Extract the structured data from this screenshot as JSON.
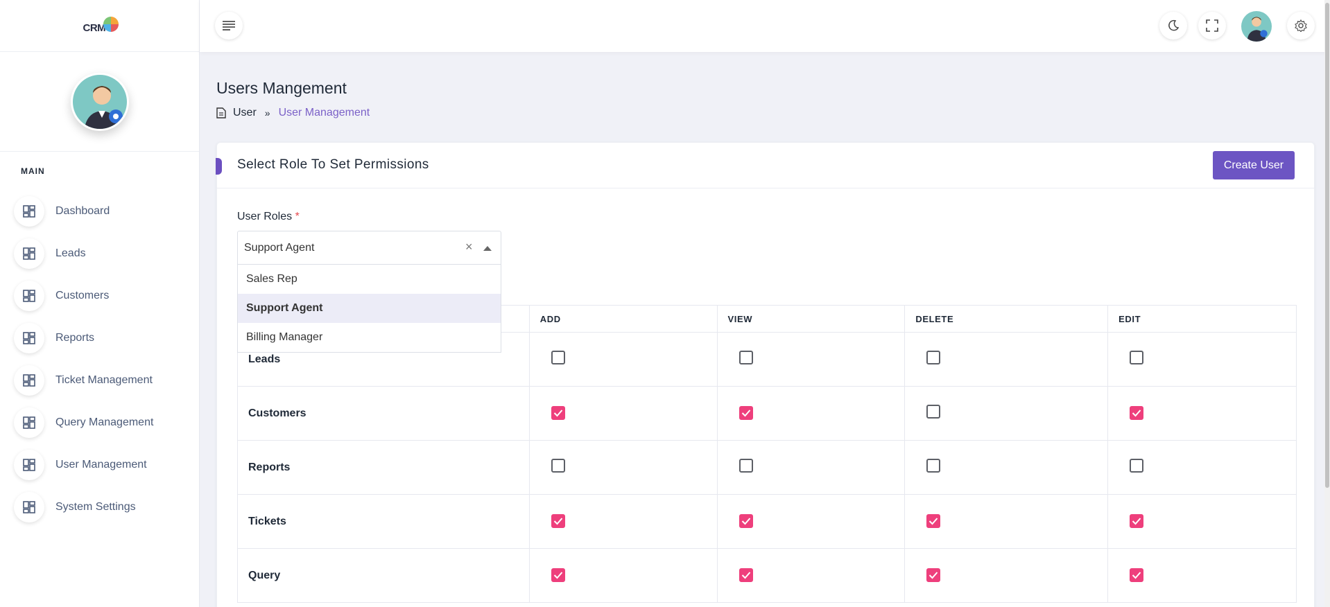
{
  "app": {
    "logo_text": "CRM"
  },
  "sidebar": {
    "section_label": "MAIN",
    "items": [
      {
        "label": "Dashboard"
      },
      {
        "label": "Leads"
      },
      {
        "label": "Customers"
      },
      {
        "label": "Reports"
      },
      {
        "label": "Ticket Management"
      },
      {
        "label": "Query Management"
      },
      {
        "label": "User Management"
      },
      {
        "label": "System Settings"
      }
    ]
  },
  "header": {
    "menu_icon": "menu-icon",
    "dark_mode_icon": "moon-icon",
    "fullscreen_icon": "fullscreen-icon",
    "settings_icon": "gear-icon"
  },
  "page": {
    "title": "Users Mangement",
    "breadcrumb": {
      "root": "User",
      "current": "User Management"
    }
  },
  "card": {
    "title": "Select Role To Set Permissions",
    "create_button": "Create User",
    "field_label": "User Roles",
    "required_mark": "*",
    "select": {
      "value": "Support Agent",
      "clear": "×",
      "options": [
        {
          "label": "Sales Rep",
          "selected": false
        },
        {
          "label": "Support Agent",
          "selected": true
        },
        {
          "label": "Billing Manager",
          "selected": false
        }
      ]
    }
  },
  "permissions": {
    "columns": [
      "",
      "ADD",
      "VIEW",
      "DELETE",
      "EDIT"
    ],
    "rows": [
      {
        "name": "Leads",
        "add": false,
        "view": false,
        "delete": false,
        "edit": false
      },
      {
        "name": "Customers",
        "add": true,
        "view": true,
        "delete": false,
        "edit": true
      },
      {
        "name": "Reports",
        "add": false,
        "view": false,
        "delete": false,
        "edit": false
      },
      {
        "name": "Tickets",
        "add": true,
        "view": true,
        "delete": true,
        "edit": true
      },
      {
        "name": "Query",
        "add": true,
        "view": true,
        "delete": true,
        "edit": true
      }
    ]
  },
  "colors": {
    "accent": "#6c55c3",
    "checkbox_on": "#ee3f7c",
    "breadcrumb_active": "#7b61c8"
  }
}
